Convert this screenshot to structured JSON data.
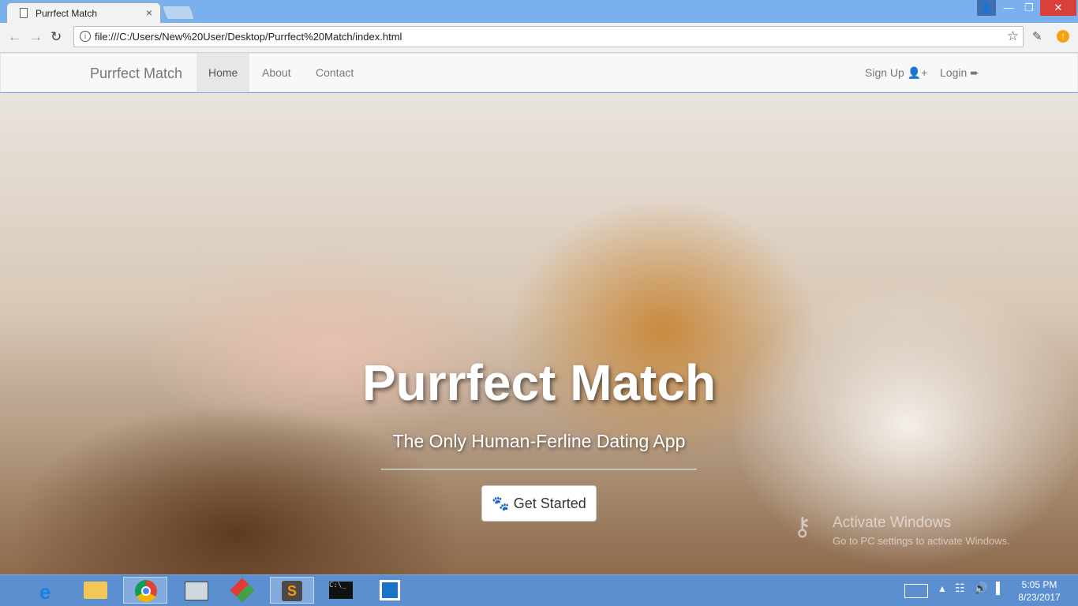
{
  "browser": {
    "tab_title": "Purrfect Match",
    "tab_close": "×",
    "url": "file:///C:/Users/New%20User/Desktop/Purrfect%20Match/index.html",
    "icons": {
      "back": "←",
      "forward": "→",
      "reload": "↻",
      "info": "i",
      "star": "☆",
      "eyedropper": "✎",
      "update": "↑"
    },
    "window": {
      "user": "👤",
      "minimize": "—",
      "maximize": "❐",
      "close": "✕"
    }
  },
  "navbar": {
    "brand": "Purrfect Match",
    "links": [
      "Home",
      "About",
      "Contact"
    ],
    "active": "Home",
    "signup": "Sign Up",
    "signup_icon": "user-plus-icon",
    "login": "Login",
    "login_icon": "sign-in-icon"
  },
  "hero": {
    "title": "Purrfect Match",
    "subtitle": "The Only Human-Ferline Dating App",
    "cta": "Get Started",
    "cta_icon": "paw-icon"
  },
  "watermark": {
    "title": "Activate Windows",
    "subtitle": "Go to PC settings to activate Windows."
  },
  "taskbar": {
    "apps": [
      "internet-explorer",
      "file-explorer",
      "chrome",
      "app",
      "app",
      "sublime-text",
      "command-prompt",
      "brackets"
    ],
    "time": "5:05 PM",
    "date": "8/23/2017"
  },
  "colors": {
    "taskbar": "#5b8fd0",
    "navbar": "#f8f8f8",
    "close": "#d9403a"
  }
}
